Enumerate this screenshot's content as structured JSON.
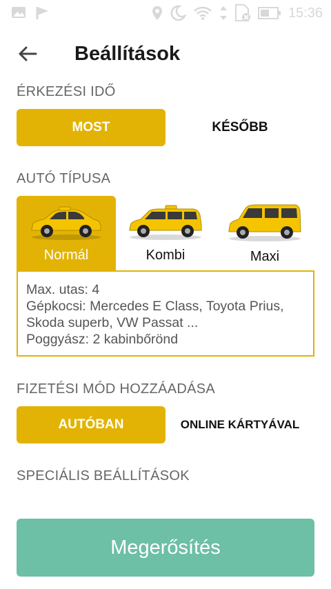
{
  "status_bar": {
    "time": "15:36",
    "icons": [
      "image-icon",
      "check-flag-icon",
      "location-icon",
      "moon-icon",
      "wifi-icon",
      "data-arrows-icon",
      "sim-off-icon",
      "battery-icon"
    ]
  },
  "appbar": {
    "title": "Beállítások",
    "back_icon": "arrow-left-icon"
  },
  "arrival": {
    "label": "ÉRKEZÉSI IDŐ",
    "options": [
      "MOST",
      "KÉSŐBB"
    ],
    "selected": "MOST"
  },
  "car_type": {
    "label": "AUTÓ TÍPUSA",
    "options": [
      {
        "label": "Normál",
        "icon": "sedan-taxi-icon"
      },
      {
        "label": "Kombi",
        "icon": "wagon-taxi-icon"
      },
      {
        "label": "Maxi",
        "icon": "van-taxi-icon"
      }
    ],
    "selected": "Normál",
    "info": {
      "line1": "Max. utas: 4",
      "line2": "Gépkocsi: Mercedes E Class, Toyota Prius,",
      "line3": "Skoda superb, VW Passat ...",
      "line4": "Poggyász: 2 kabinbőrönd"
    }
  },
  "payment": {
    "label": "FIZETÉSI MÓD HOZZÁADÁSA",
    "options": [
      "AUTÓBAN",
      "ONLINE KÁRTYÁVAL"
    ],
    "selected": "AUTÓBAN"
  },
  "special": {
    "label": "SPECIÁLIS BEÁLLÍTÁSOK"
  },
  "confirm_label": "Megerősítés",
  "colors": {
    "accent": "#e2b304",
    "confirm": "#6dbfa6",
    "label_gray": "#666666",
    "taxi_yellow": "#f5c400"
  }
}
